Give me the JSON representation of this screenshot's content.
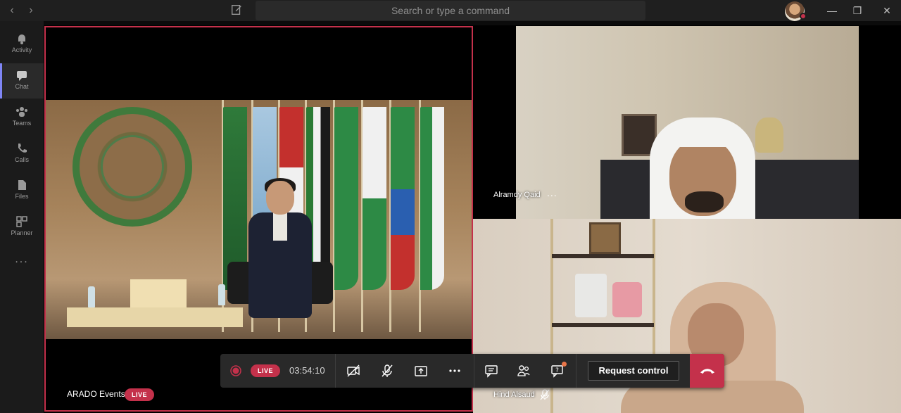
{
  "titlebar": {
    "search_placeholder": "Search or type a command",
    "back_icon": "chevron-left-icon",
    "forward_icon": "chevron-right-icon",
    "compose_icon": "compose-icon",
    "window_buttons": [
      "minimize",
      "restore",
      "close"
    ]
  },
  "rail": {
    "items": [
      {
        "label": "Activity",
        "icon": "bell-icon",
        "active": false
      },
      {
        "label": "Chat",
        "icon": "chat-icon",
        "active": true
      },
      {
        "label": "Teams",
        "icon": "teams-icon",
        "active": false
      },
      {
        "label": "Calls",
        "icon": "phone-icon",
        "active": false
      },
      {
        "label": "Files",
        "icon": "file-icon",
        "active": false
      },
      {
        "label": "Planner",
        "icon": "planner-icon",
        "active": false
      }
    ],
    "more_label": "..."
  },
  "meeting": {
    "main_speaker": {
      "name": "ARADO Events",
      "live": "LIVE"
    },
    "participants": [
      {
        "name": "Alramdy Qaid",
        "more": "..."
      },
      {
        "name": "Hind Alsaud",
        "muted": true
      }
    ],
    "controls": {
      "live_label": "LIVE",
      "timer": "03:54:10",
      "request_control": "Request control"
    },
    "accent": "#c4314b"
  }
}
